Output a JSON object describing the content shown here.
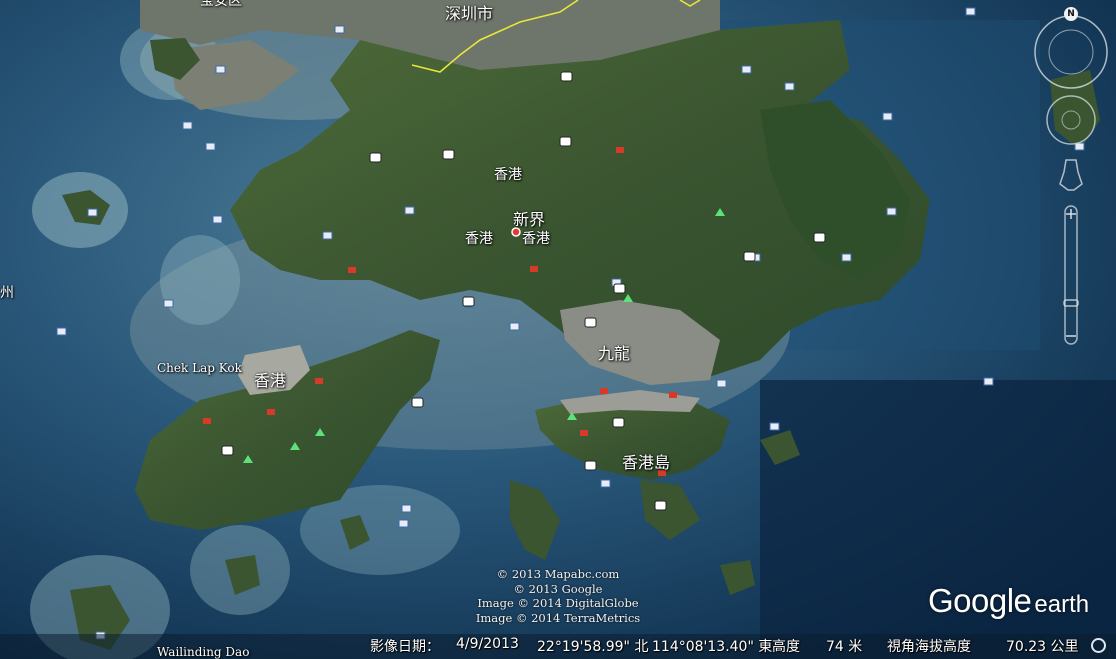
{
  "map_labels": {
    "shenzhen": "深圳市",
    "partial_top": "宝安区",
    "hongkong_north": "香港",
    "new_territories": "新界",
    "hongkong_left": "香港",
    "hongkong_right": "香港",
    "chek_lap_kok": "Chek Lap Kok",
    "hongkong_airport": "香港",
    "kowloon": "九龍",
    "hk_island": "香港島",
    "wailingding": "Wailinding Dao",
    "left_edge": "州"
  },
  "credits": [
    "© 2013 Mapabc.com",
    "© 2013 Google",
    "Image © 2014 DigitalGlobe",
    "Image © 2014 TerraMetrics"
  ],
  "logo": {
    "brand": "Google",
    "product": "earth"
  },
  "status_bar": {
    "imagery_date_label": "影像日期：",
    "imagery_date": "4/9/2013",
    "latitude": "22°19'58.99\" 北",
    "longitude": "114°08'13.40\" 東",
    "elevation_label": "高度",
    "elevation": "74 米",
    "eye_alt_label": "視角海拔高度",
    "eye_alt": "70.23 公里"
  },
  "compass": {
    "north": "N"
  },
  "colors": {
    "sea_deep": "#0c2b4a",
    "sea_shallow": "#5d8aa0",
    "land": "#3d5a30",
    "border": "#e8e63a"
  }
}
